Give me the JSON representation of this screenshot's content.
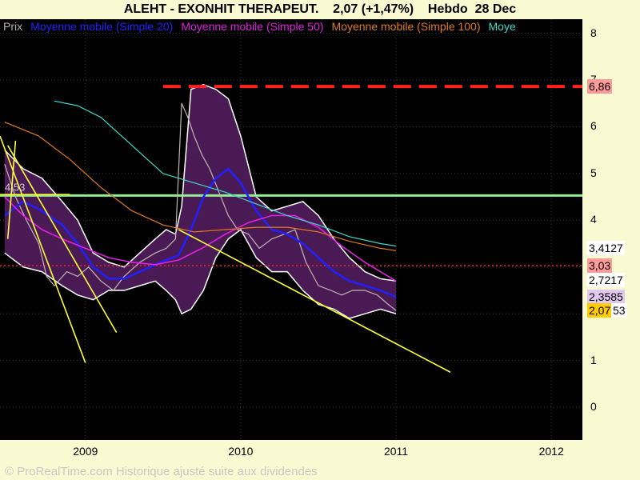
{
  "header": {
    "ticker": "ALEHT - EXONHIT THERAPEUT.",
    "price": "2,07 (+1,47%)",
    "period": "Hebdo",
    "date": "28 Dec"
  },
  "legend": [
    {
      "label": "Prix",
      "color": "#b0b0b0"
    },
    {
      "label": "Moyenne mobile (Simple 20)",
      "color": "#2020ff"
    },
    {
      "label": "Moyenne mobile (Simple 50)",
      "color": "#e020e0"
    },
    {
      "label": "Moyenne mobile (Simple 100)",
      "color": "#e07a20"
    },
    {
      "label": "Moye",
      "color": "#40d8c8"
    }
  ],
  "credit": "© ProRealTime.com Historique ajusté suite aux dividendes",
  "chart_data": {
    "type": "line",
    "ylim": [
      -0.7,
      8.3
    ],
    "xlim": [
      2008.45,
      2012.2
    ],
    "x_ticks": [
      {
        "label": "2009",
        "x": 2009.0
      },
      {
        "label": "2010",
        "x": 2010.0
      },
      {
        "label": "2011",
        "x": 2011.0
      },
      {
        "label": "2012",
        "x": 2012.0
      }
    ],
    "y_ticks": [
      0,
      1,
      2,
      3,
      4,
      5,
      6,
      7,
      8
    ],
    "price_labels": [
      {
        "text": "6,86",
        "value": 6.86,
        "bg": "#ff9a9a"
      },
      {
        "text": "3,4127",
        "value": 3.4127,
        "bg": "#ffffff"
      },
      {
        "text": "3,03",
        "value": 3.03,
        "bg": "#ff9a9a"
      },
      {
        "text": "2,7217",
        "value": 2.7217,
        "bg": "#ffffff"
      },
      {
        "text": "2,3585",
        "value": 2.3585,
        "bg": "#e0c8f0"
      },
      {
        "text": "2,07",
        "value": 2.07,
        "bg": "#ffcc00"
      },
      {
        "text": "53",
        "value": 2.07,
        "bg": "#ffffff"
      }
    ],
    "annotation": {
      "text": "4,53",
      "value": 4.53
    },
    "horizontal_lines": [
      {
        "value": 6.86,
        "color": "#ff2020",
        "style": "dashed",
        "from": 2009.5
      },
      {
        "value": 4.53,
        "color": "#90ee90",
        "style": "solid",
        "from": 2008.45
      },
      {
        "value": 3.03,
        "color": "#ff2020",
        "style": "dotted",
        "from": 2008.45
      }
    ],
    "trendlines": [
      {
        "x": [
          2008.45,
          2009.0
        ],
        "y": [
          5.8,
          0.95
        ]
      },
      {
        "x": [
          2008.5,
          2009.2
        ],
        "y": [
          5.6,
          1.6
        ]
      },
      {
        "x": [
          2008.5,
          2008.55
        ],
        "y": [
          3.6,
          5.7
        ]
      },
      {
        "x": [
          2009.6,
          2011.35
        ],
        "y": [
          3.8,
          0.75
        ]
      },
      {
        "x": [
          2008.45,
          2008.9
        ],
        "y": [
          4.55,
          4.55
        ]
      }
    ],
    "series": [
      {
        "name": "Prix",
        "x": [
          2008.48,
          2008.55,
          2008.62,
          2008.7,
          2008.75,
          2008.8,
          2008.88,
          2008.95,
          2009.02,
          2009.1,
          2009.18,
          2009.25,
          2009.35,
          2009.45,
          2009.52,
          2009.58,
          2009.62,
          2009.66,
          2009.7,
          2009.75,
          2009.8,
          2009.86,
          2009.92,
          2009.98,
          2010.05,
          2010.12,
          2010.2,
          2010.28,
          2010.35,
          2010.42,
          2010.5,
          2010.58,
          2010.65,
          2010.72,
          2010.8,
          2010.88,
          2010.95,
          2011.0
        ],
        "values": [
          5.2,
          4.5,
          4.0,
          3.5,
          2.8,
          2.6,
          2.9,
          2.8,
          3.0,
          2.7,
          2.5,
          2.8,
          3.1,
          3.3,
          3.4,
          3.6,
          6.5,
          6.2,
          5.8,
          5.4,
          5.1,
          4.6,
          4.1,
          3.8,
          3.7,
          3.4,
          3.6,
          3.7,
          3.8,
          3.1,
          2.6,
          2.5,
          2.4,
          2.5,
          2.5,
          2.4,
          2.2,
          2.07
        ]
      },
      {
        "name": "Moyenne mobile (Simple 20)",
        "x": [
          2008.48,
          2008.6,
          2008.72,
          2008.85,
          2008.95,
          2009.05,
          2009.15,
          2009.25,
          2009.35,
          2009.45,
          2009.52,
          2009.6,
          2009.68,
          2009.76,
          2009.84,
          2009.92,
          2010.0,
          2010.1,
          2010.2,
          2010.3,
          2010.4,
          2010.5,
          2010.6,
          2010.7,
          2010.8,
          2010.9,
          2011.0
        ],
        "values": [
          4.1,
          4.4,
          4.2,
          3.9,
          3.5,
          3.0,
          2.75,
          2.75,
          2.9,
          3.05,
          3.15,
          3.25,
          3.8,
          4.5,
          4.9,
          5.1,
          4.8,
          4.2,
          3.8,
          3.7,
          3.5,
          3.2,
          2.9,
          2.7,
          2.6,
          2.5,
          2.36
        ]
      },
      {
        "name": "Moyenne mobile (Simple 50)",
        "x": [
          2008.48,
          2008.6,
          2008.72,
          2008.85,
          2009.0,
          2009.15,
          2009.3,
          2009.45,
          2009.6,
          2009.75,
          2009.9,
          2010.05,
          2010.2,
          2010.35,
          2010.5,
          2010.65,
          2010.8,
          2010.95,
          2011.0
        ],
        "values": [
          4.5,
          4.1,
          3.8,
          3.6,
          3.4,
          3.2,
          3.1,
          3.05,
          3.15,
          3.4,
          3.7,
          3.95,
          4.1,
          4.1,
          3.85,
          3.45,
          3.1,
          2.8,
          2.7
        ]
      },
      {
        "name": "Moyenne mobile (Simple 100)",
        "x": [
          2008.48,
          2008.7,
          2008.9,
          2009.1,
          2009.3,
          2009.5,
          2009.7,
          2009.9,
          2010.1,
          2010.3,
          2010.5,
          2010.7,
          2010.9,
          2011.0
        ],
        "values": [
          6.1,
          5.8,
          5.3,
          4.7,
          4.2,
          3.9,
          3.75,
          3.8,
          3.85,
          3.85,
          3.75,
          3.55,
          3.4,
          3.35
        ]
      },
      {
        "name": "Moye",
        "x": [
          2008.8,
          2008.95,
          2009.1,
          2009.3,
          2009.5,
          2009.7,
          2009.9,
          2010.1,
          2010.3,
          2010.5,
          2010.7,
          2010.9,
          2011.0
        ],
        "values": [
          6.55,
          6.45,
          6.2,
          5.6,
          5.0,
          4.8,
          4.6,
          4.35,
          4.1,
          3.9,
          3.65,
          3.5,
          3.45
        ]
      }
    ],
    "band": {
      "x": [
        2008.48,
        2008.6,
        2008.72,
        2008.85,
        2008.95,
        2009.05,
        2009.15,
        2009.25,
        2009.35,
        2009.45,
        2009.52,
        2009.58,
        2009.62,
        2009.68,
        2009.76,
        2009.84,
        2009.92,
        2010.0,
        2010.1,
        2010.2,
        2010.3,
        2010.4,
        2010.5,
        2010.6,
        2010.7,
        2010.8,
        2010.9,
        2011.0
      ],
      "upper": [
        5.5,
        5.1,
        4.9,
        4.4,
        4.0,
        3.3,
        3.1,
        3.0,
        3.3,
        3.6,
        3.8,
        3.7,
        4.3,
        6.8,
        6.9,
        6.8,
        6.6,
        5.8,
        4.5,
        4.2,
        4.3,
        4.4,
        4.1,
        3.6,
        3.2,
        2.9,
        2.75,
        2.7
      ],
      "lower": [
        3.3,
        3.0,
        2.9,
        2.6,
        2.4,
        2.3,
        2.5,
        2.5,
        2.6,
        2.7,
        2.5,
        2.3,
        2.0,
        2.1,
        2.5,
        3.2,
        3.6,
        3.8,
        3.2,
        2.9,
        2.9,
        2.5,
        2.2,
        2.1,
        1.9,
        2.0,
        2.1,
        2.0
      ]
    }
  }
}
